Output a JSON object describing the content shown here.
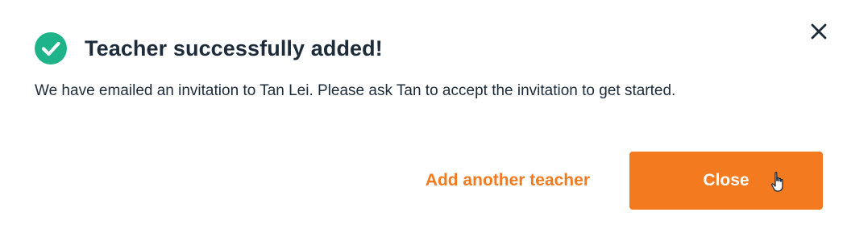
{
  "dialog": {
    "title": "Teacher successfully added!",
    "message": "We have emailed an invitation to Tan Lei. Please ask Tan to accept the invitation to get started.",
    "icons": {
      "success": "check-circle-icon",
      "close": "close-icon",
      "cursor": "hand-pointer-icon"
    },
    "buttons": {
      "add_another_label": "Add another teacher",
      "close_label": "Close"
    }
  },
  "colors": {
    "accent": "#f47a1f",
    "success": "#1fb38a",
    "text": "#1d2b3a",
    "background": "#ffffff"
  }
}
